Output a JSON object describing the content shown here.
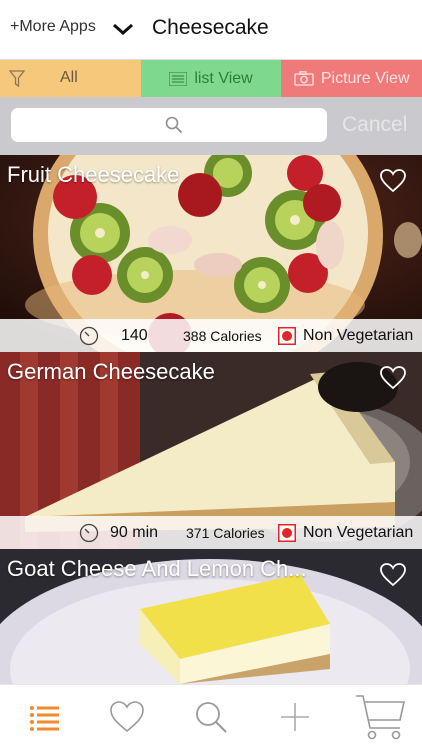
{
  "header": {
    "more_apps": "+More Apps",
    "title": "Cheesecake"
  },
  "filters": {
    "all": "All",
    "list": "list View",
    "picture": "Picture View"
  },
  "search": {
    "placeholder": "",
    "cancel": "Cancel"
  },
  "recipes": [
    {
      "name": "Fruit Cheesecake",
      "time": "140",
      "calories": "388 Calories",
      "type": "Non Vegetarian"
    },
    {
      "name": "German Cheesecake",
      "time": "90 min",
      "calories": "371 Calories",
      "type": "Non Vegetarian"
    },
    {
      "name": "Goat Cheese And Lemon Ch...",
      "time": "",
      "calories": "",
      "type": ""
    }
  ],
  "colors": {
    "accent": "#f28a2e",
    "all_filter": "#f6c87c",
    "list_filter": "#7fd98c",
    "picture_filter": "#f07a7a",
    "non_veg": "#e0262a"
  }
}
